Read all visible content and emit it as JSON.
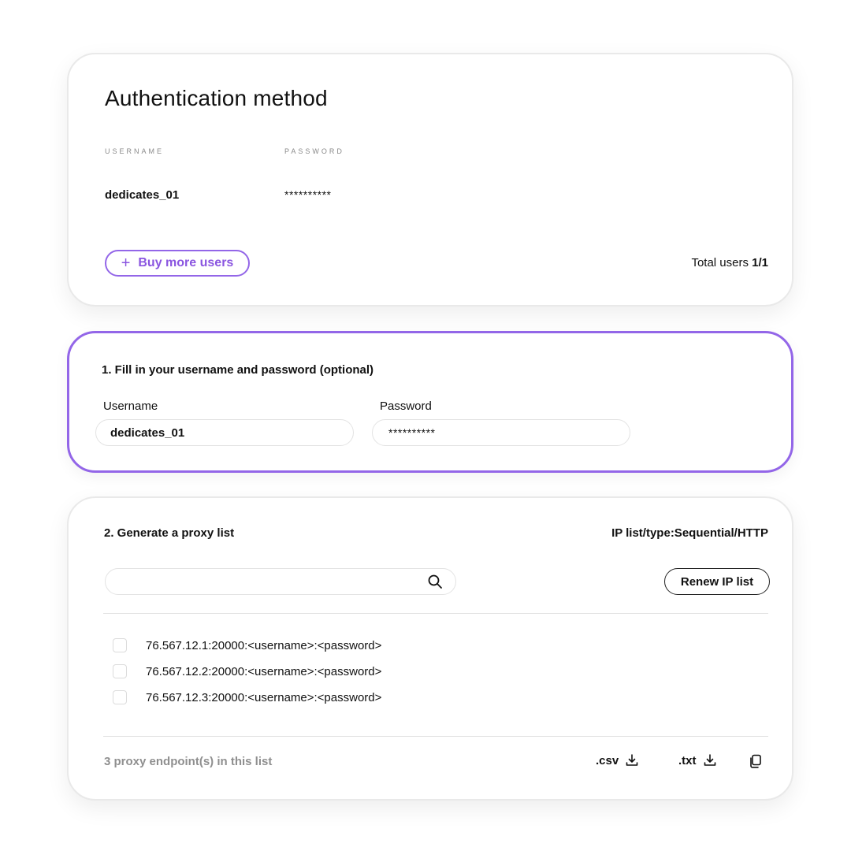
{
  "auth": {
    "title": "Authentication method",
    "username_col": "USERNAME",
    "password_col": "PASSWORD",
    "username_value": "dedicates_01",
    "password_value": "**********",
    "buy_more_label": "Buy more users",
    "total_label": "Total users ",
    "total_value": "1/1"
  },
  "fill": {
    "title": "1. Fill in your username and password (optional)",
    "username_label": "Username",
    "password_label": "Password",
    "username_value": "dedicates_01",
    "password_value": "**********"
  },
  "generate": {
    "title": "2. Generate a proxy list",
    "ip_type": "IP list/type:Sequential/HTTP",
    "search_placeholder": "",
    "renew_label": "Renew IP list",
    "proxies": [
      "76.567.12.1:20000:<username>:<password>",
      "76.567.12.2:20000:<username>:<password>",
      "76.567.12.3:20000:<username>:<password>"
    ],
    "count_text": "3 proxy endpoint(s) in this list",
    "csv_label": ".csv",
    "txt_label": ".txt"
  },
  "colors": {
    "accent": "#9366e8",
    "accent_text": "#8a55e0",
    "muted": "#8f8f8f"
  },
  "icons": [
    "plus-icon",
    "search-icon",
    "download-icon",
    "copy-icon"
  ]
}
